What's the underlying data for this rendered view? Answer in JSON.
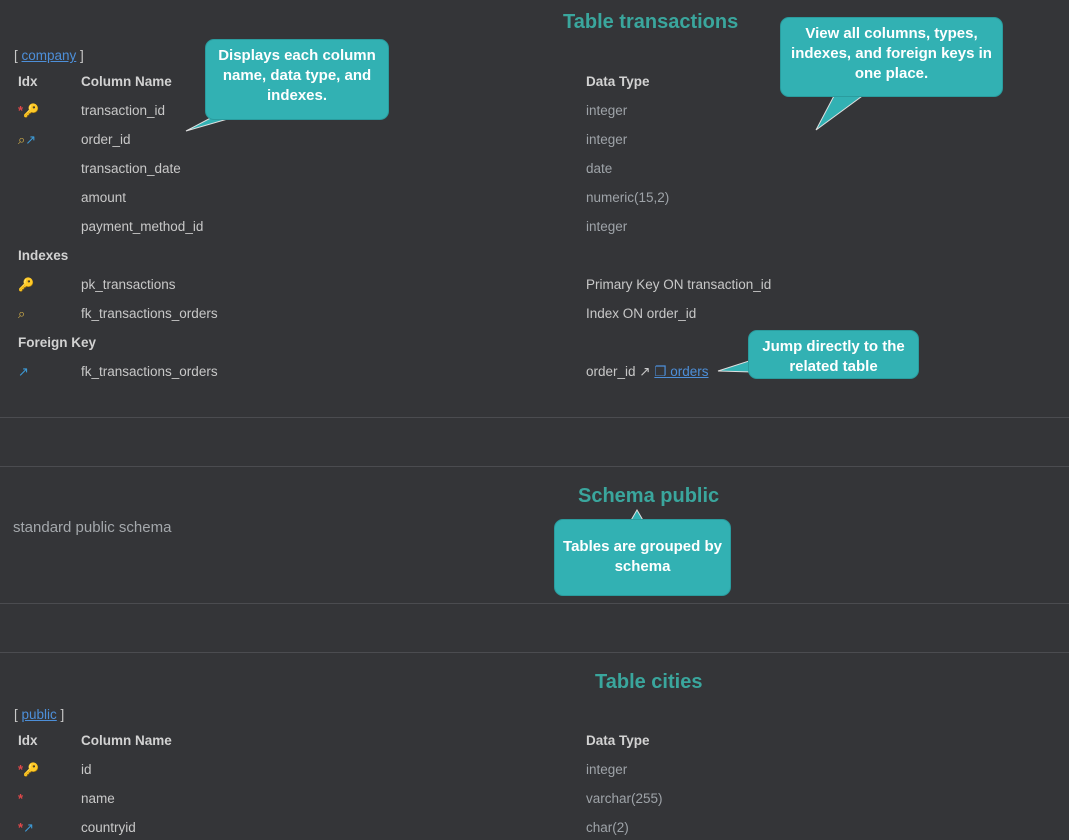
{
  "colors": {
    "background": "#343538",
    "title": "#3aa69d",
    "callout": "#32b1b3",
    "link": "#4d8fd9",
    "primary_key": "#e6b23a",
    "required": "#e0484a",
    "foreign_key": "#3d9ad6"
  },
  "transactions": {
    "title": "Table transactions",
    "crumb_open": "[ ",
    "crumb_link": "company",
    "crumb_close": " ]",
    "headers": {
      "idx": "Idx",
      "column": "Column Name",
      "type": "Data Type"
    },
    "columns": [
      {
        "icons": "required-primary-key",
        "name": "transaction_id",
        "type": "integer"
      },
      {
        "icons": "index-foreign-key",
        "name": "order_id",
        "type": "integer"
      },
      {
        "icons": "",
        "name": "transaction_date",
        "type": "date"
      },
      {
        "icons": "",
        "name": "amount",
        "type": "numeric(15,2)"
      },
      {
        "icons": "",
        "name": "payment_method_id",
        "type": "integer"
      }
    ],
    "indexes_label": "Indexes",
    "indexes": [
      {
        "icon": "key-icon",
        "name": "pk_transactions",
        "def": "Primary Key ON transaction_id"
      },
      {
        "icon": "magnifier-icon",
        "name": "fk_transactions_orders",
        "def": "Index ON order_id"
      }
    ],
    "fk_label": "Foreign Key",
    "foreign_keys": [
      {
        "name": "fk_transactions_orders",
        "def_prefix": "order_id ↗ ",
        "target_icon": "❐",
        "target": " orders"
      }
    ]
  },
  "schema": {
    "title": "Schema public",
    "description": "standard public schema"
  },
  "cities": {
    "title": "Table cities",
    "crumb_open": "[ ",
    "crumb_link": "public",
    "crumb_close": " ]",
    "headers": {
      "idx": "Idx",
      "column": "Column Name",
      "type": "Data Type"
    },
    "columns": [
      {
        "icons": "required-primary-key",
        "name": "id",
        "type": "integer"
      },
      {
        "icons": "required",
        "name": "name",
        "type": "varchar(255)"
      },
      {
        "icons": "required-foreign-key",
        "name": "countryid",
        "type": "char(2)"
      }
    ]
  },
  "callouts": {
    "columns": "Displays each column name, data type, and indexes.",
    "overview": "View all columns, types, indexes, and foreign keys in one place.",
    "jump": "Jump directly to the related table",
    "schema": "Tables are grouped by schema"
  },
  "glyphs": {
    "star": "*",
    "key": "🔑",
    "magnifier": "⌕",
    "fk_arrow": "↗"
  }
}
